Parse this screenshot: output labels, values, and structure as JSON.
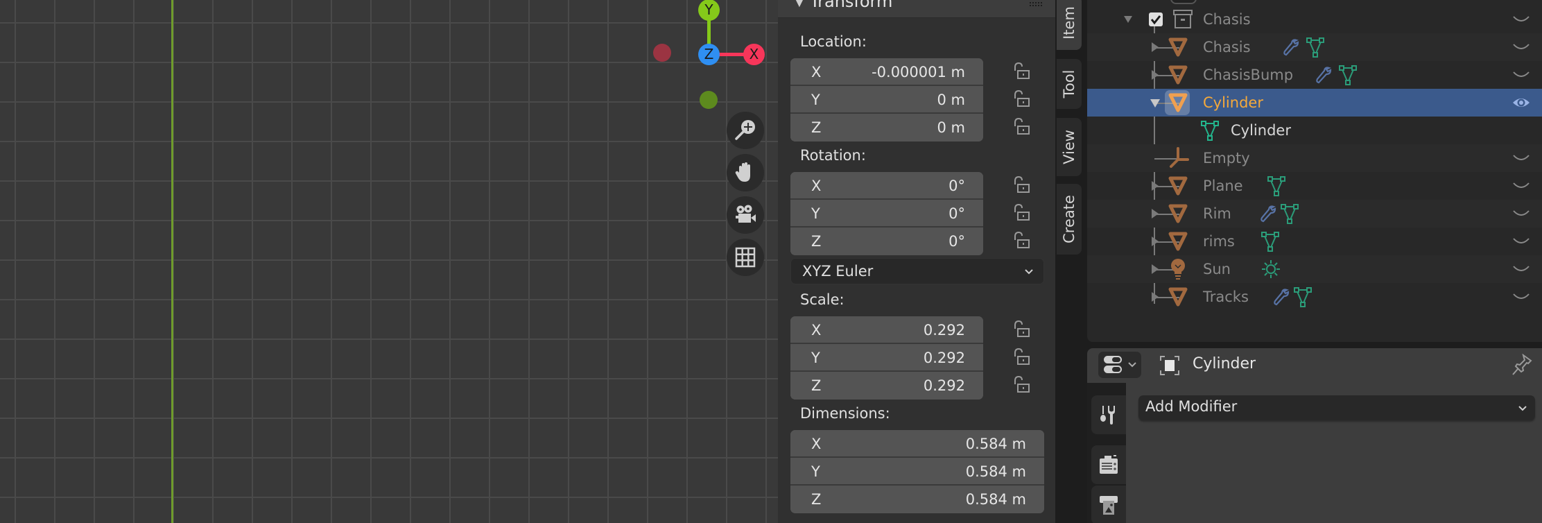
{
  "viewport": {
    "gizmo": {
      "x_label": "X",
      "y_label": "Y",
      "z_label": "Z",
      "colors": {
        "x": "#f7365a",
        "y": "#85c91a",
        "z": "#2f8ff2",
        "neg_x": "#9b3442",
        "neg_y": "#5d8a1e"
      }
    },
    "nav_buttons": [
      {
        "name": "zoom",
        "icon": "zoom-in-icon"
      },
      {
        "name": "pan",
        "icon": "hand-icon"
      },
      {
        "name": "camera",
        "icon": "camera-icon"
      },
      {
        "name": "ortho",
        "icon": "grid-icon"
      }
    ]
  },
  "npanel": {
    "panel_title": "Transform",
    "location": {
      "label": "Location:",
      "fields": [
        {
          "axis": "X",
          "value": "-0.000001 m"
        },
        {
          "axis": "Y",
          "value": "0 m"
        },
        {
          "axis": "Z",
          "value": "0 m"
        }
      ]
    },
    "rotation": {
      "label": "Rotation:",
      "fields": [
        {
          "axis": "X",
          "value": "0°"
        },
        {
          "axis": "Y",
          "value": "0°"
        },
        {
          "axis": "Z",
          "value": "0°"
        }
      ],
      "mode": "XYZ Euler"
    },
    "scale": {
      "label": "Scale:",
      "fields": [
        {
          "axis": "X",
          "value": "0.292"
        },
        {
          "axis": "Y",
          "value": "0.292"
        },
        {
          "axis": "Z",
          "value": "0.292"
        }
      ]
    },
    "dimensions": {
      "label": "Dimensions:",
      "fields": [
        {
          "axis": "X",
          "value": "0.584 m"
        },
        {
          "axis": "Y",
          "value": "0.584 m"
        },
        {
          "axis": "Z",
          "value": "0.584 m"
        }
      ]
    },
    "tabs": [
      "Item",
      "Tool",
      "View",
      "Create"
    ],
    "active_tab": "Item"
  },
  "outliner": {
    "rows": [
      {
        "name": "Chasis",
        "type": "collection",
        "checked": true
      },
      {
        "name": "Chasis",
        "type": "mesh",
        "modifier": true,
        "data": "mesh"
      },
      {
        "name": "ChasisBump",
        "type": "mesh",
        "modifier": true,
        "data": "mesh"
      },
      {
        "name": "Cylinder",
        "type": "mesh",
        "selected": true
      },
      {
        "name": "Cylinder",
        "type": "mesh-data"
      },
      {
        "name": "Empty",
        "type": "empty"
      },
      {
        "name": "Plane",
        "type": "mesh",
        "data": "mesh"
      },
      {
        "name": "Rim",
        "type": "mesh",
        "modifier": true,
        "data": "mesh"
      },
      {
        "name": "rims",
        "type": "mesh",
        "data": "mesh"
      },
      {
        "name": "Sun",
        "type": "light",
        "data": "sun"
      },
      {
        "name": "Tracks",
        "type": "mesh",
        "modifier": true,
        "data": "mesh"
      }
    ],
    "colors": {
      "selection": "#3b5a8c",
      "active_name": "#f5a93a",
      "object_icon": "#a2693f",
      "data_icon": "#2b9c79",
      "modifier_icon": "#5873a6"
    }
  },
  "properties": {
    "object_name": "Cylinder",
    "add_modifier_label": "Add Modifier",
    "side_tabs": [
      "modifiers-icon",
      "particles-icon",
      "physics-icon"
    ]
  }
}
